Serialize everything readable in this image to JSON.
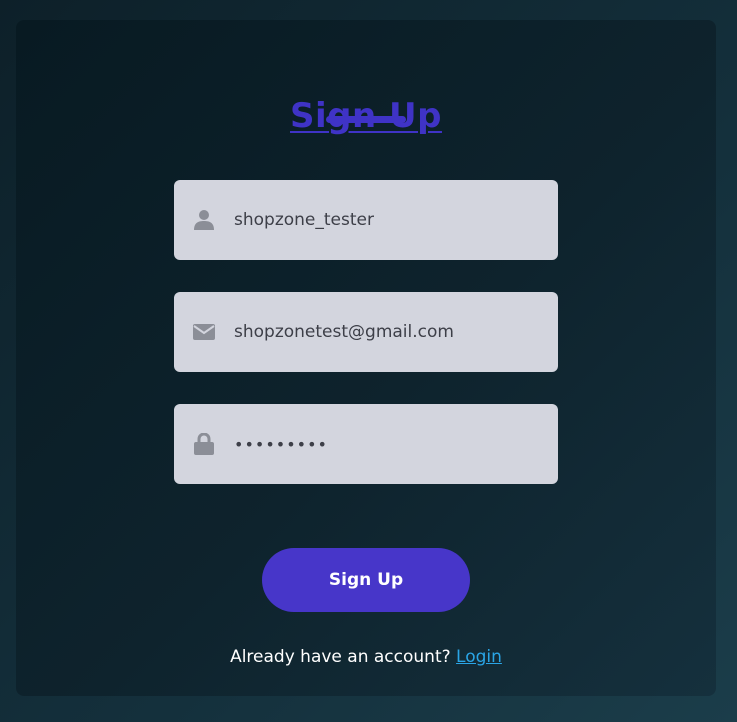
{
  "form": {
    "title": "Sign Up",
    "username": {
      "value": "shopzone_tester",
      "icon": "user-icon"
    },
    "email": {
      "value": "shopzonetest@gmail.com",
      "icon": "envelope-icon"
    },
    "password": {
      "value": "password1",
      "icon": "lock-icon"
    },
    "submit_label": "Sign Up",
    "footer_text": "Already have an account?",
    "login_link": "Login"
  },
  "colors": {
    "accent": "#3f33c6",
    "button": "#4736c9",
    "field_bg": "#d3d5de",
    "link": "#2aa5e6",
    "icon": "#8b8e97"
  }
}
